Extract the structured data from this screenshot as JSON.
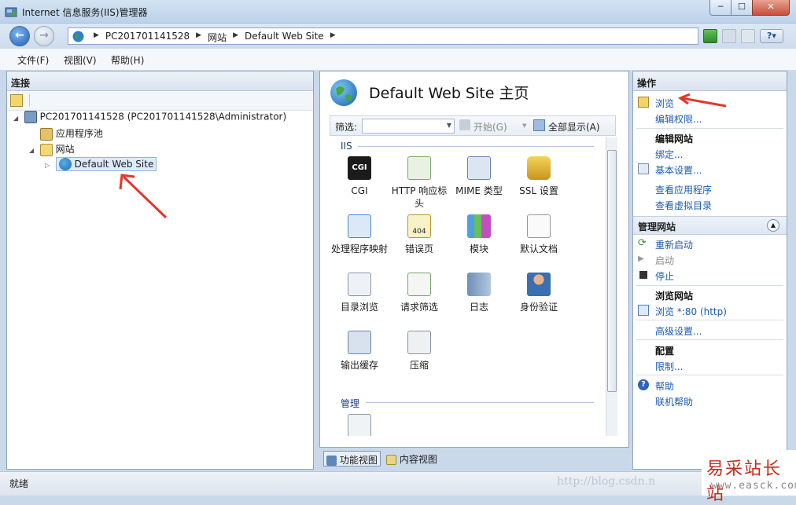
{
  "window": {
    "title": "Internet 信息服务(IIS)管理器",
    "minimize": "─",
    "maximize": "☐",
    "close": "✕"
  },
  "nav": {
    "crumbs": [
      "PC201701141528",
      "网站",
      "Default Web Site"
    ],
    "help_label": "?▾"
  },
  "menu": [
    "文件(F)",
    "视图(V)",
    "帮助(H)"
  ],
  "connections": {
    "header": "连接",
    "tree": [
      {
        "label": "PC201701141528 (PC201701141528\\Administrator)",
        "expander": "◢"
      },
      {
        "label": "应用程序池",
        "expander": ""
      },
      {
        "label": "网站",
        "expander": "◢"
      },
      {
        "label": "Default Web Site",
        "expander": "▷"
      }
    ]
  },
  "center": {
    "title": "Default Web Site 主页",
    "filter_label": "筛选:",
    "start_label": "开始(G)",
    "show_all_label": "全部显示(A)",
    "groups": [
      {
        "name": "IIS",
        "features": [
          "CGI",
          "HTTP 响应标头",
          "MIME 类型",
          "SSL 设置",
          "处理程序映射",
          "错误页",
          "模块",
          "默认文档",
          "目录浏览",
          "请求筛选",
          "日志",
          "身份验证",
          "输出缓存",
          "压缩"
        ]
      },
      {
        "name": "管理",
        "features": [
          ""
        ]
      }
    ],
    "cgi_badge": "CGI",
    "err_badge": "404",
    "tabs": [
      "功能视图",
      "内容视图"
    ]
  },
  "actions": {
    "header": "操作",
    "items": [
      {
        "label": "浏览",
        "type": "link"
      },
      {
        "label": "编辑权限...",
        "type": "link"
      },
      {
        "label": "编辑网站",
        "type": "bold"
      },
      {
        "label": "绑定...",
        "type": "link"
      },
      {
        "label": "基本设置...",
        "type": "link"
      },
      {
        "label": "查看应用程序",
        "type": "link"
      },
      {
        "label": "查看虚拟目录",
        "type": "link"
      },
      {
        "label": "管理网站",
        "type": "section"
      },
      {
        "label": "重新启动",
        "type": "link"
      },
      {
        "label": "启动",
        "type": "disabled"
      },
      {
        "label": "停止",
        "type": "link"
      },
      {
        "label": "浏览网站",
        "type": "bold"
      },
      {
        "label": "浏览 *:80 (http)",
        "type": "link"
      },
      {
        "label": "高级设置...",
        "type": "link"
      },
      {
        "label": "配置",
        "type": "bold"
      },
      {
        "label": "限制...",
        "type": "link"
      },
      {
        "label": "帮助",
        "type": "link"
      },
      {
        "label": "联机帮助",
        "type": "link"
      }
    ]
  },
  "status": {
    "text": "就绪",
    "watermark": "http://blog.csdn.n"
  },
  "logo": {
    "text": "易采站长站",
    "url": "www.easck.com"
  },
  "colors": {
    "accent": "#1a5ab4",
    "arrow": "#e8342a"
  }
}
